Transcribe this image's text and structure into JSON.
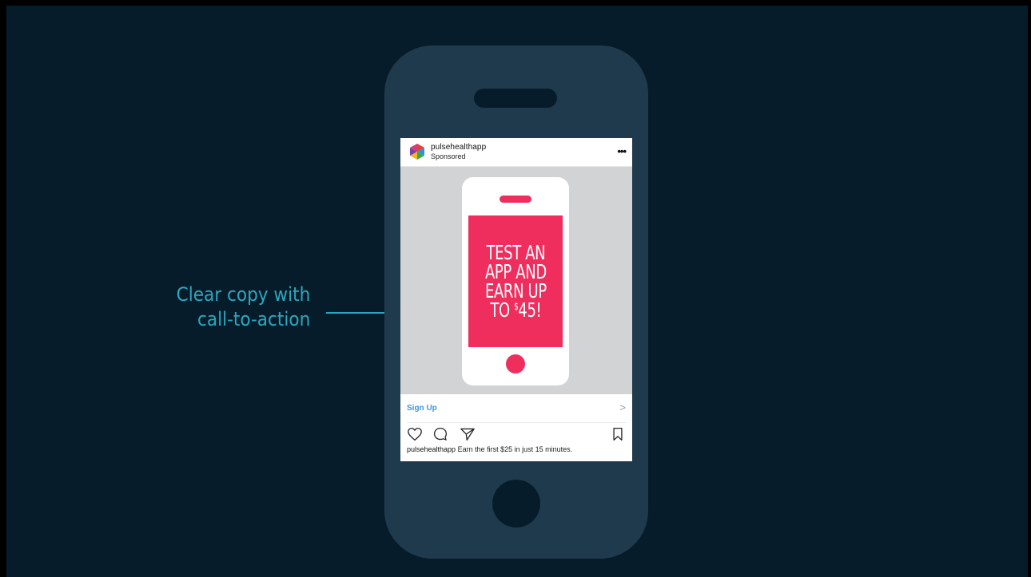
{
  "annotation": {
    "lines": [
      "Clear copy with",
      "call-to-action"
    ],
    "color": "#2aa8bf"
  },
  "post": {
    "username": "pulsehealthapp",
    "sponsored_label": "Sponsored",
    "more_icon": "more-options-icon",
    "image": {
      "headline_lines": [
        "TEST AN",
        "APP AND",
        "EARN UP"
      ],
      "last_line_prefix": "TO ",
      "currency_symbol": "$",
      "last_line_amount": "45!",
      "accent_color": "#ef2e5e"
    },
    "cta": {
      "label": "Sign Up",
      "icon": "chevron-right-icon",
      "color": "#3897f0"
    },
    "actions": [
      "heart-icon",
      "comment-icon",
      "share-icon",
      "bookmark-icon"
    ],
    "caption": {
      "user": "pulsehealthapp",
      "text": "Earn the first $25 in just 15 minutes."
    }
  },
  "colors": {
    "background": "#071c2a",
    "phone_body": "#203a4d"
  }
}
